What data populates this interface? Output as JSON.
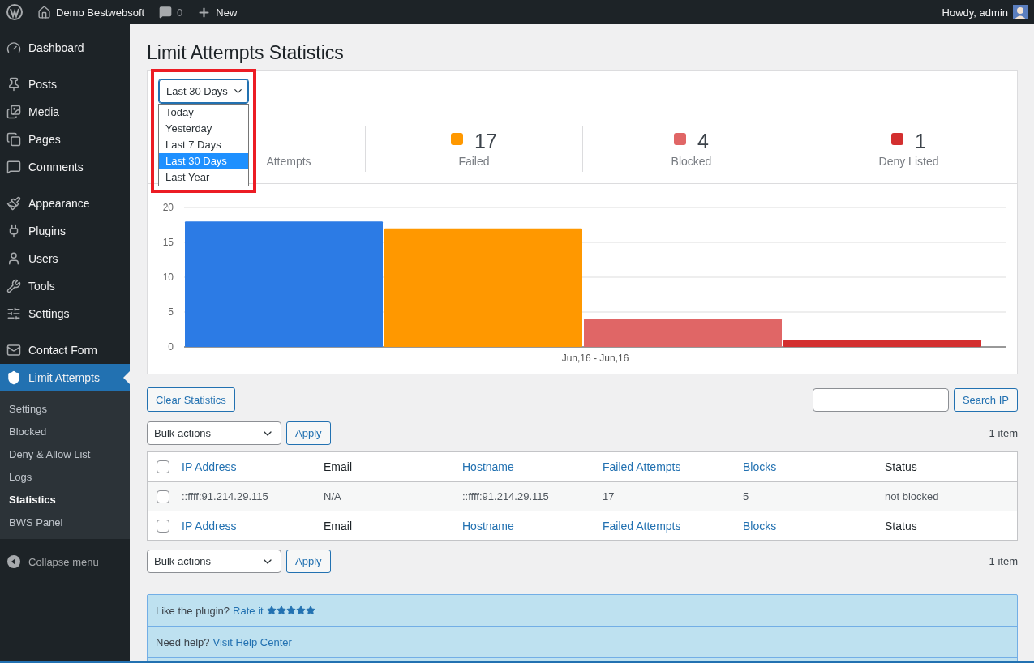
{
  "admin_bar": {
    "site": "Demo Bestwebsoft",
    "comments": "0",
    "new": "New",
    "greeting": "Howdy, admin"
  },
  "sidebar": {
    "groups": [
      [
        {
          "label": "Dashboard",
          "selected": false
        }
      ],
      [
        {
          "label": "Posts",
          "selected": false
        },
        {
          "label": "Media",
          "selected": false
        },
        {
          "label": "Pages",
          "selected": false
        },
        {
          "label": "Comments",
          "selected": false
        }
      ],
      [
        {
          "label": "Appearance",
          "selected": false
        },
        {
          "label": "Plugins",
          "selected": false
        },
        {
          "label": "Users",
          "selected": false
        },
        {
          "label": "Tools",
          "selected": false
        },
        {
          "label": "Settings",
          "selected": false
        }
      ],
      [
        {
          "label": "Contact Form",
          "selected": false
        },
        {
          "label": "Limit Attempts",
          "selected": true,
          "children": [
            {
              "label": "Settings",
              "selected": false
            },
            {
              "label": "Blocked",
              "selected": false
            },
            {
              "label": "Deny & Allow List",
              "selected": false
            },
            {
              "label": "Logs",
              "selected": false
            },
            {
              "label": "Statistics",
              "selected": true
            },
            {
              "label": "BWS Panel",
              "selected": false
            }
          ]
        }
      ]
    ],
    "collapse": "Collapse menu"
  },
  "page_title": "Limit Attempts Statistics",
  "period_select": {
    "value": "Last 30 Days",
    "expanded": true,
    "options": [
      {
        "label": "Today",
        "selected": false
      },
      {
        "label": "Yesterday",
        "selected": false
      },
      {
        "label": "Last 7 Days",
        "selected": false
      },
      {
        "label": "Last 30 Days",
        "selected": true
      },
      {
        "label": "Last Year",
        "selected": false
      }
    ]
  },
  "stats": [
    {
      "label": "Attempts"
    },
    {
      "value": "17",
      "label": "Failed",
      "color": "#ff9800"
    },
    {
      "value": "4",
      "label": "Blocked",
      "color": "#e06666"
    },
    {
      "value": "1",
      "label": "Deny Listed",
      "color": "#d32f2f"
    }
  ],
  "chart_data": {
    "type": "bar",
    "categories": [
      "Jun,16 - Jun,16"
    ],
    "series": [
      {
        "color": "#2c7be5",
        "values": [
          18
        ]
      },
      {
        "color": "#ff9800",
        "values": [
          17
        ]
      },
      {
        "color": "#e06666",
        "values": [
          4
        ]
      },
      {
        "color": "#d32f2f",
        "values": [
          1
        ]
      }
    ],
    "ylim": [
      0,
      20
    ],
    "yticks": [
      0,
      5,
      10,
      15,
      20
    ],
    "grid": true
  },
  "clear_button": "Clear Statistics",
  "search_button": "Search IP",
  "bulk_top": {
    "value": "Bulk actions",
    "apply": "Apply",
    "count": "1 item"
  },
  "table": {
    "columns": [
      {
        "label": "IP Address",
        "sortable": true
      },
      {
        "label": "Email",
        "sortable": false
      },
      {
        "label": "Hostname",
        "sortable": true
      },
      {
        "label": "Failed Attempts",
        "sortable": true
      },
      {
        "label": "Blocks",
        "sortable": true
      },
      {
        "label": "Status",
        "sortable": false
      }
    ],
    "rows": [
      {
        "checked": false,
        "cells": [
          "::ffff:91.214.29.115",
          "N/A",
          "::ffff:91.214.29.115",
          "17",
          "5",
          "not blocked"
        ]
      }
    ],
    "footer_columns": [
      {
        "label": "IP Address",
        "sortable": true
      },
      {
        "label": "Email",
        "sortable": false
      },
      {
        "label": "Hostname",
        "sortable": true
      },
      {
        "label": "Failed Attempts",
        "sortable": true
      },
      {
        "label": "Blocks",
        "sortable": true
      },
      {
        "label": "Status",
        "sortable": false
      }
    ],
    "header_checked": false,
    "footer_checked": false
  },
  "bulk_bottom": {
    "value": "Bulk actions",
    "apply": "Apply",
    "count": "1 item"
  },
  "info_box": {
    "rate_text": "Like the plugin?",
    "rate_link": "Rate it",
    "stars": 5,
    "help_text": "Need help?",
    "help_link": "Visit Help Center"
  }
}
